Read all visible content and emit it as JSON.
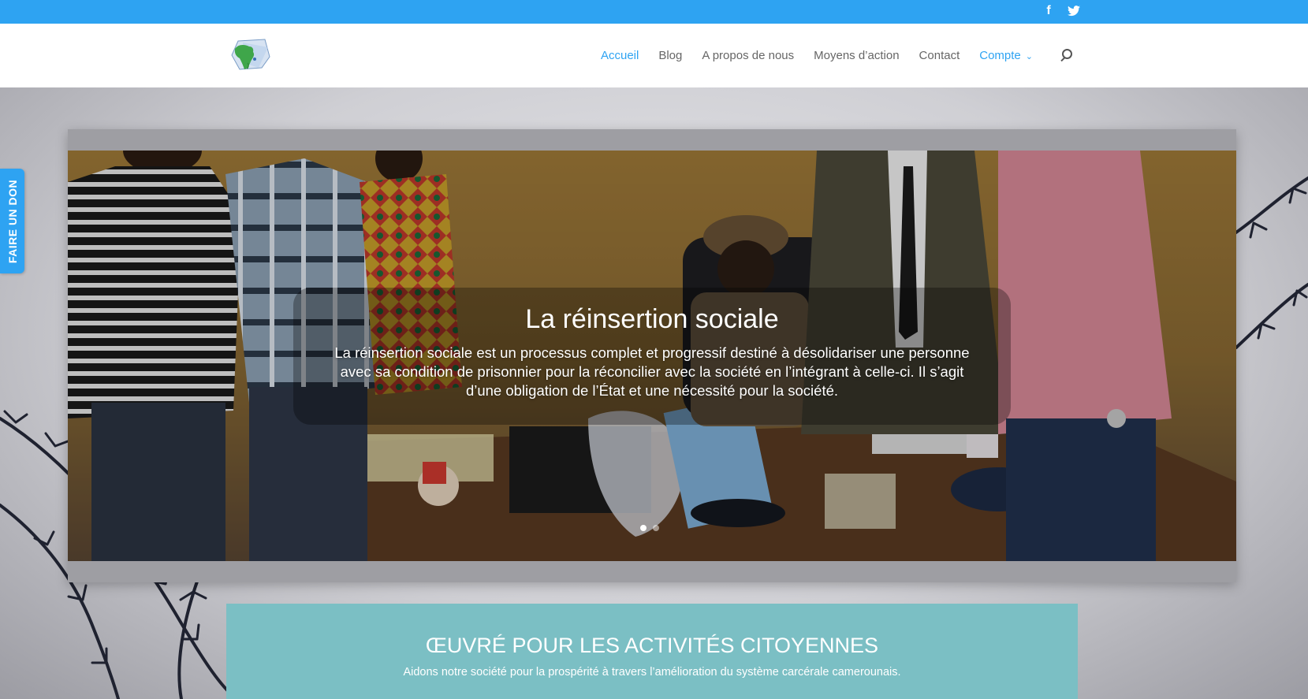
{
  "colors": {
    "accent": "#2ea3f2",
    "nav_text": "#666666",
    "teal_section": "#7bbfc4"
  },
  "topbar": {
    "social": [
      {
        "icon": "facebook-icon",
        "glyph": "f"
      },
      {
        "icon": "twitter-icon",
        "glyph": "t"
      }
    ]
  },
  "header": {
    "logo_icon": "africa-map-logo",
    "nav": {
      "accueil": "Accueil",
      "blog": "Blog",
      "apropos": "A propos de nous",
      "moyens": "Moyens d’action",
      "contact": "Contact",
      "compte": "Compte"
    },
    "search_icon": "search-icon"
  },
  "donate_tab": {
    "label": "FAIRE UN DON"
  },
  "slider": {
    "title": "La réinsertion sociale",
    "text": "La réinsertion sociale est un processus complet et progressif destiné à désolidariser une personne avec sa condition de prisonnier pour la réconcilier avec la société en l’intégrant à celle-ci. Il s’agit d’une obligation de l’État et une nécessité pour la société.",
    "slide_count": 2,
    "active_slide": 1
  },
  "section": {
    "title": "ŒUVRÉ POUR LES ACTIVITÉS CITOYENNES",
    "subtitle": "Aidons notre société pour la prospérité à travers l’amélioration du système carcérale camerounais."
  }
}
